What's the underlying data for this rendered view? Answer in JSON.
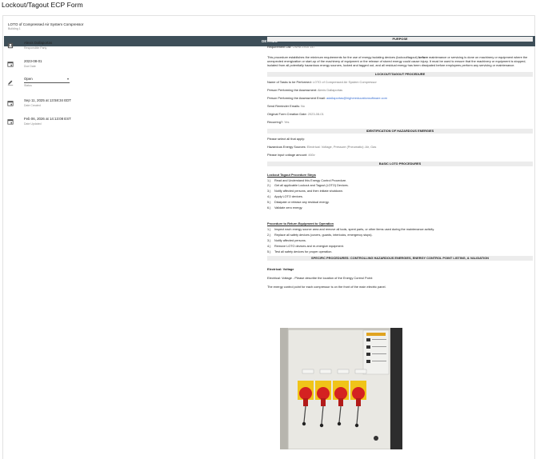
{
  "page": {
    "title": "Lockout/Tagout ECP Form"
  },
  "form": {
    "title": "LOTO of Compressed Air System Compressor",
    "subtitle": "Building 1"
  },
  "details_label": "DETAILS",
  "left_fields": [
    {
      "icon": "person-badge-icon",
      "value": "Alexis Dallaportas",
      "label": "Responsible Party"
    },
    {
      "icon": "calendar-icon",
      "value": "2023-08-01",
      "label": "Due Date"
    },
    {
      "icon": "calendar-icon",
      "value": "Sep 11, 2025 at 13:58:34 EDT",
      "label": "Date Created"
    },
    {
      "icon": "calendar-icon",
      "value": "Feb 06, 2026 at 14:13:08 EST",
      "label": "Date Updated"
    }
  ],
  "status": {
    "icon": "status-edit-icon",
    "value": "Open",
    "label": "Status"
  },
  "purpose": {
    "header": "PURPOSE",
    "req_label": "Requirement List:",
    "req_value": "OSHA 1910.147",
    "p1": "This procedure establishes the minimum requirements for the use of energy isolating devices (lockout/tagout)",
    "p_bold": "before",
    "p2": "maintenance or servicing is done on machinery or equipment where the unexpected energization or start-up of the machinery of equipment or the release of stored energy could cause injury. It must be used to ensure that the machinery or equipment is stopped, isolated from all potentially hazardous energy sources, locked and tagged out, and all residual energy has been dissipated before employees perform any servicing or maintenance."
  },
  "loto": {
    "header": "LOCKOUT/TAGOUT PROCEDURE",
    "rows": [
      {
        "label": "Name of Tasks to be Performed:",
        "value": "LOTO of Compressed Air System Compressor"
      },
      {
        "label": "Person Performing the Assessment:",
        "value": "Alexis Dallaportas"
      },
      {
        "label": "Person Performing the Assessment Email:",
        "value": "adallaportas@highereducationsoftware.com",
        "link": true
      },
      {
        "label": "Send Reminder Emails:",
        "value": "No"
      },
      {
        "label": "Original Form Creation Date:",
        "value": "2023-08-01"
      },
      {
        "label": "Recurring?:",
        "value": "Yes"
      }
    ]
  },
  "hazard": {
    "header": "IDENTIFICATION OF HAZARDOUS ENERGIES",
    "select_note": "Please select all that apply:",
    "sources_label": "Hazardous Energy Sources:",
    "sources_value": "Electrical: Voltage, Pressure (Pneumatic): Air, Gas",
    "voltage_label": "Please input voltage amount:",
    "voltage_value": "460v"
  },
  "basic": {
    "header": "BASIC LOTO PROCEDURES",
    "steps_title": "Lockout Tagout Procedure Steps",
    "steps": [
      {
        "n": "1.)",
        "t": "Read and Understand this Energy Control Procedure."
      },
      {
        "n": "2.)",
        "t": "Get all applicable Lockout and Tagout (LOTO) Devices."
      },
      {
        "n": "3.)",
        "t": "Notify affected persons, and then initiate shutdown."
      },
      {
        "n": "4.)",
        "t": "Apply LOTO devices."
      },
      {
        "n": "5.)",
        "t": "Dissipate or release any residual energy."
      },
      {
        "n": "6.)",
        "t": "Validate zero energy."
      }
    ],
    "return_title": "Procedure to Return Equipment to Operation",
    "return_steps": [
      {
        "n": "1.)",
        "t": "Inspect each energy source area and remove all tools, spent parts, or other items used during the maintenance activity."
      },
      {
        "n": "2.)",
        "t": "Replace all safety devices (covers, guards, interlocks, emergency stops)."
      },
      {
        "n": "3.)",
        "t": "Notify affected persons."
      },
      {
        "n": "4.)",
        "t": "Remove LOTO devices and re-energize equipment."
      },
      {
        "n": "5.)",
        "t": "Test all safety devices for proper operation."
      }
    ]
  },
  "specific": {
    "header": "SPECIFIC PROCEDURES: CONTROLLING HAZARDOUS ENERGIES, ENERGY CONTROL POINT LISTING, & VALIDATION",
    "sub": "Electrical: Voltage",
    "desc": "Electrical: Voltage - Please describe the location of the Energy Control Point:",
    "answer": "The energy control point for each compressor is on the front of the main electric panel."
  }
}
